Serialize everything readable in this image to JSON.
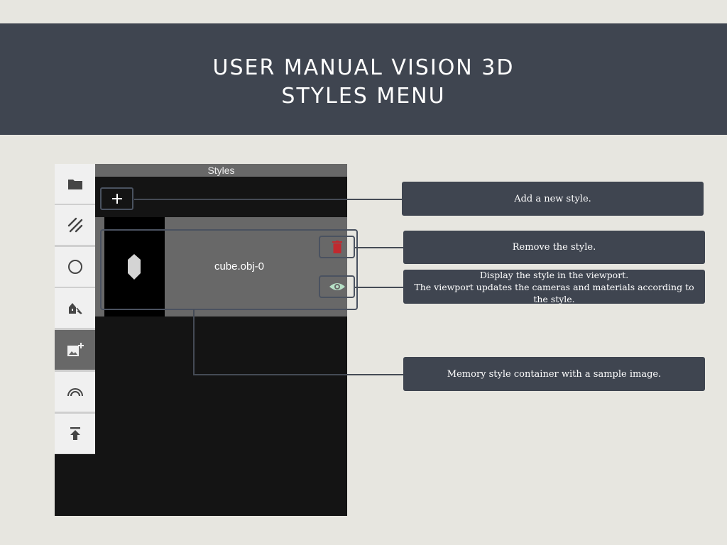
{
  "header": {
    "title_line1": "USER MANUAL VISION 3D",
    "title_line2": "STYLES MENU"
  },
  "colors": {
    "banner": "#3f4550",
    "background": "#e7e6e0",
    "delete_accent": "#c0292f",
    "eye_accent": "#b6e0c6",
    "active_sidebar": "#686868"
  },
  "sidebar": {
    "items": [
      {
        "icon": "folder-icon",
        "active": false
      },
      {
        "icon": "hatch-pattern-icon",
        "active": false
      },
      {
        "icon": "circle-icon",
        "active": false
      },
      {
        "icon": "scene-light-icon",
        "active": false
      },
      {
        "icon": "add-image-icon",
        "active": true
      },
      {
        "icon": "arc-icon",
        "active": false
      },
      {
        "icon": "upload-icon",
        "active": false
      }
    ]
  },
  "panel": {
    "title": "Styles",
    "add_icon": "plus-icon",
    "style_item": {
      "label": "cube.obj-0",
      "delete_icon": "trash-icon",
      "view_icon": "eye-icon"
    }
  },
  "callouts": {
    "add": "Add a new style.",
    "remove": "Remove the style.",
    "display_line1": "Display the style in the viewport.",
    "display_line2": "The viewport updates the cameras and materials according to",
    "display_line3": "the style.",
    "container": "Memory style container with a sample image."
  }
}
